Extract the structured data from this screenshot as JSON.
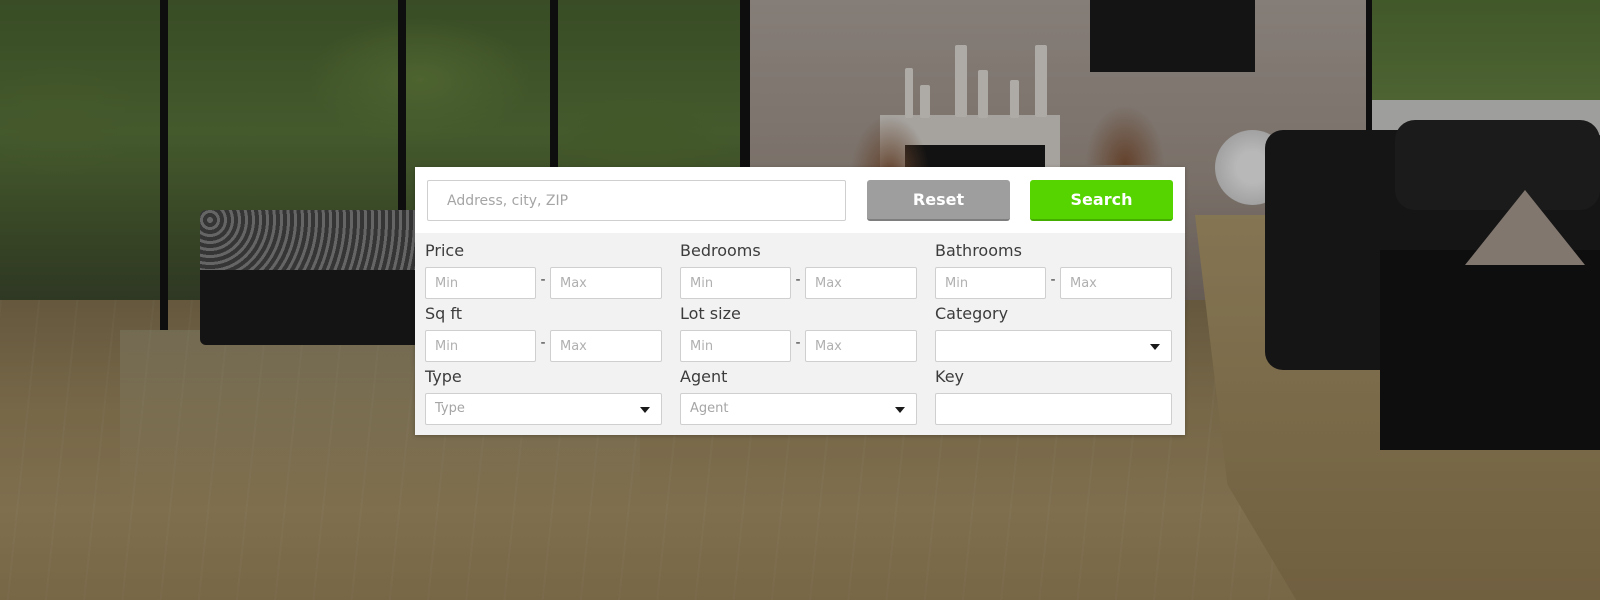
{
  "search": {
    "address_placeholder": "Address, city, ZIP",
    "reset_label": "Reset",
    "search_label": "Search"
  },
  "filters": {
    "price": {
      "label": "Price",
      "min_placeholder": "Min",
      "max_placeholder": "Max",
      "separator": "-"
    },
    "bedrooms": {
      "label": "Bedrooms",
      "min_placeholder": "Min",
      "max_placeholder": "Max",
      "separator": "-"
    },
    "bathrooms": {
      "label": "Bathrooms",
      "min_placeholder": "Min",
      "max_placeholder": "Max",
      "separator": "-"
    },
    "sqft": {
      "label": "Sq ft",
      "min_placeholder": "Min",
      "max_placeholder": "Max",
      "separator": "-"
    },
    "lot_size": {
      "label": "Lot size",
      "min_placeholder": "Min",
      "max_placeholder": "Max",
      "separator": "-"
    },
    "category": {
      "label": "Category",
      "selected": ""
    },
    "type": {
      "label": "Type",
      "selected": "Type"
    },
    "agent": {
      "label": "Agent",
      "selected": "Agent"
    },
    "key": {
      "label": "Key",
      "value": ""
    }
  },
  "colors": {
    "search_button": "#55d400",
    "reset_button": "#9e9e9e",
    "panel_background": "#f2f2f2"
  },
  "icons": {
    "dropdown": "caret-down-icon"
  }
}
